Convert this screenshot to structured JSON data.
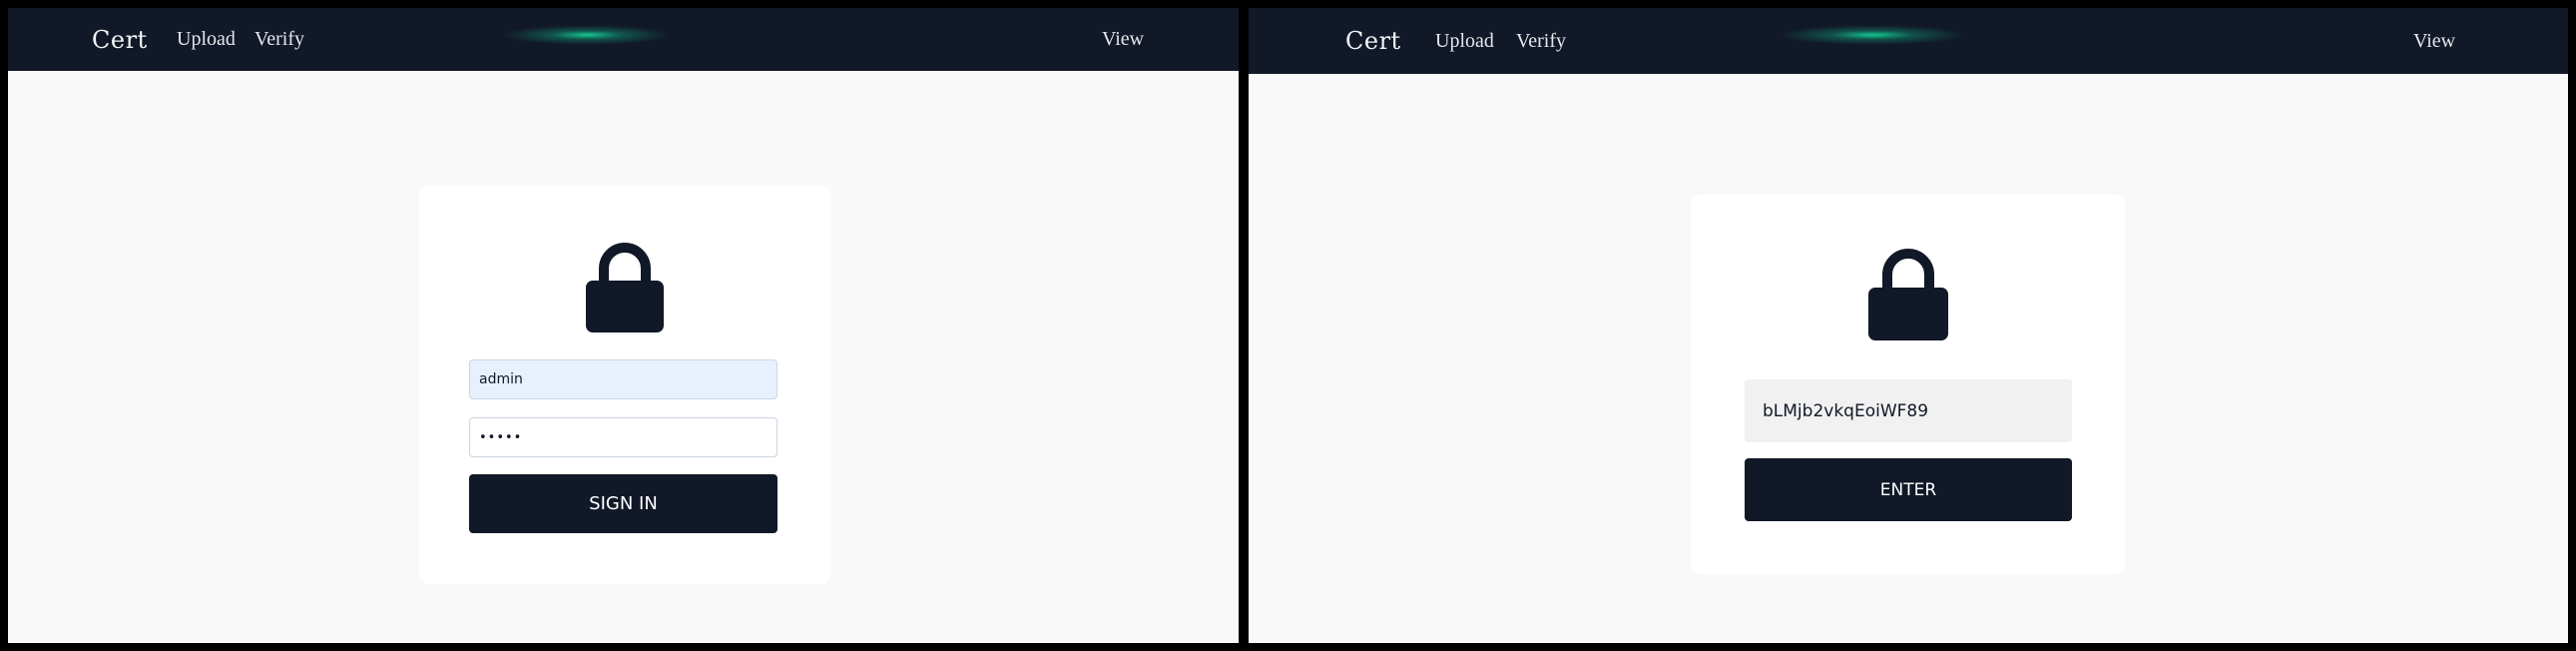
{
  "colors": {
    "navbar": "#111827",
    "page_background": "#f9f9f9",
    "card": "#ffffff",
    "button": "#111827",
    "autofill_input": "#e8f0fe",
    "code_input": "#f1f1f1",
    "glow_accent": "#14e6a0"
  },
  "left": {
    "nav": {
      "brand": "Cert",
      "links": [
        "Upload",
        "Verify"
      ],
      "right_link": "View"
    },
    "login": {
      "icon": "lock-icon",
      "username_value": "admin",
      "password_value": "•••••",
      "submit_label": "SIGN IN"
    }
  },
  "right": {
    "nav": {
      "brand": "Cert",
      "links": [
        "Upload",
        "Verify"
      ],
      "right_link": "View"
    },
    "access": {
      "icon": "lock-icon",
      "code_value": "bLMjb2vkqEoiWF89",
      "submit_label": "ENTER"
    }
  }
}
